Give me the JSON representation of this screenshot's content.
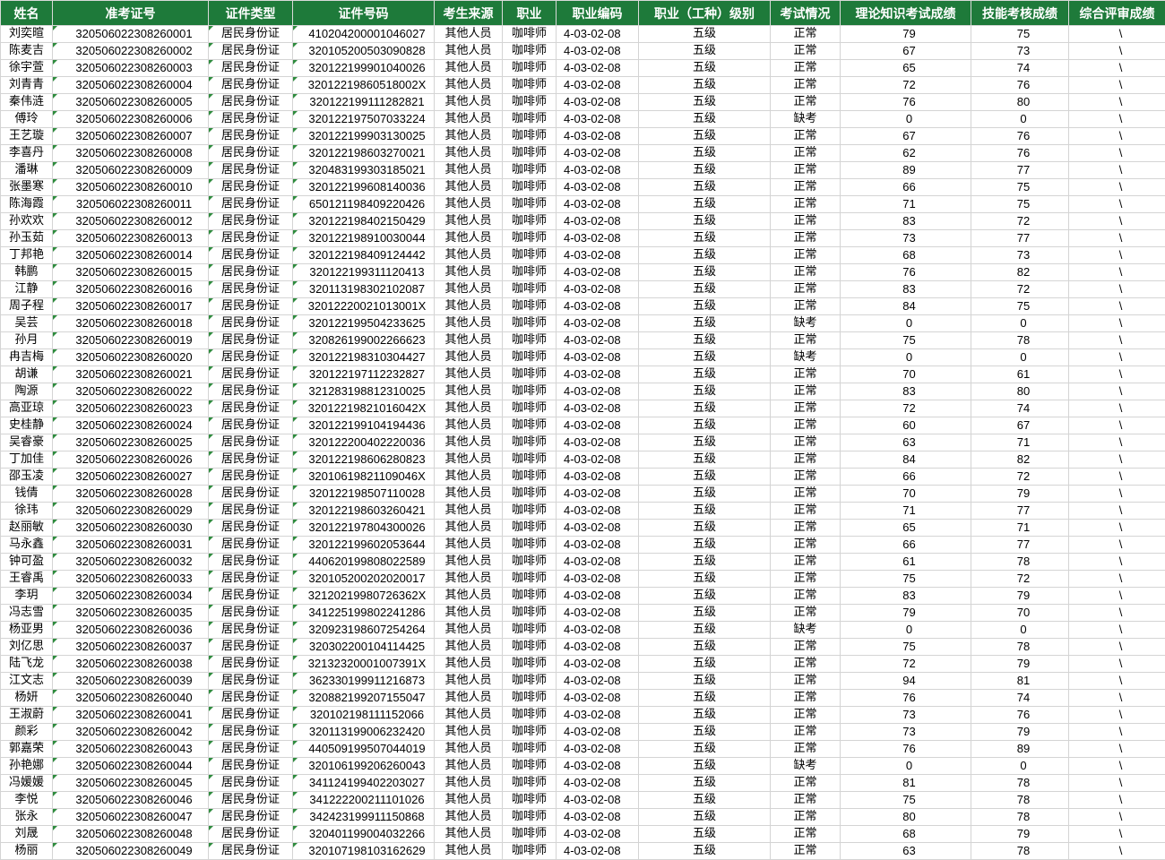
{
  "headers": [
    "姓名",
    "准考证号",
    "证件类型",
    "证件号码",
    "考生来源",
    "职业",
    "职业编码",
    "职业（工种）级别",
    "考试情况",
    "理论知识考试成绩",
    "技能考核成绩",
    "综合评审成绩"
  ],
  "rows": [
    [
      "刘奕暄",
      "320506022308260001",
      "居民身份证",
      "410204200001046027",
      "其他人员",
      "咖啡师",
      "4-03-02-08",
      "五级",
      "正常",
      "79",
      "75",
      "\\"
    ],
    [
      "陈麦吉",
      "320506022308260002",
      "居民身份证",
      "320105200503090828",
      "其他人员",
      "咖啡师",
      "4-03-02-08",
      "五级",
      "正常",
      "67",
      "73",
      "\\"
    ],
    [
      "徐宇萱",
      "320506022308260003",
      "居民身份证",
      "320122199901040026",
      "其他人员",
      "咖啡师",
      "4-03-02-08",
      "五级",
      "正常",
      "65",
      "74",
      "\\"
    ],
    [
      "刘青青",
      "320506022308260004",
      "居民身份证",
      "32012219860518002X",
      "其他人员",
      "咖啡师",
      "4-03-02-08",
      "五级",
      "正常",
      "72",
      "76",
      "\\"
    ],
    [
      "秦伟涟",
      "320506022308260005",
      "居民身份证",
      "320122199111282821",
      "其他人员",
      "咖啡师",
      "4-03-02-08",
      "五级",
      "正常",
      "76",
      "80",
      "\\"
    ],
    [
      "傅玲",
      "320506022308260006",
      "居民身份证",
      "320122197507033224",
      "其他人员",
      "咖啡师",
      "4-03-02-08",
      "五级",
      "缺考",
      "0",
      "0",
      "\\"
    ],
    [
      "王艺璇",
      "320506022308260007",
      "居民身份证",
      "320122199903130025",
      "其他人员",
      "咖啡师",
      "4-03-02-08",
      "五级",
      "正常",
      "67",
      "76",
      "\\"
    ],
    [
      "李喜丹",
      "320506022308260008",
      "居民身份证",
      "320122198603270021",
      "其他人员",
      "咖啡师",
      "4-03-02-08",
      "五级",
      "正常",
      "62",
      "76",
      "\\"
    ],
    [
      "潘琳",
      "320506022308260009",
      "居民身份证",
      "320483199303185021",
      "其他人员",
      "咖啡师",
      "4-03-02-08",
      "五级",
      "正常",
      "89",
      "77",
      "\\"
    ],
    [
      "张墨寒",
      "320506022308260010",
      "居民身份证",
      "320122199608140036",
      "其他人员",
      "咖啡师",
      "4-03-02-08",
      "五级",
      "正常",
      "66",
      "75",
      "\\"
    ],
    [
      "陈海霞",
      "320506022308260011",
      "居民身份证",
      "650121198409220426",
      "其他人员",
      "咖啡师",
      "4-03-02-08",
      "五级",
      "正常",
      "71",
      "75",
      "\\"
    ],
    [
      "孙欢欢",
      "320506022308260012",
      "居民身份证",
      "320122198402150429",
      "其他人员",
      "咖啡师",
      "4-03-02-08",
      "五级",
      "正常",
      "83",
      "72",
      "\\"
    ],
    [
      "孙玉茹",
      "320506022308260013",
      "居民身份证",
      "320122198910030044",
      "其他人员",
      "咖啡师",
      "4-03-02-08",
      "五级",
      "正常",
      "73",
      "77",
      "\\"
    ],
    [
      "丁邦艳",
      "320506022308260014",
      "居民身份证",
      "320122198409124442",
      "其他人员",
      "咖啡师",
      "4-03-02-08",
      "五级",
      "正常",
      "68",
      "73",
      "\\"
    ],
    [
      "韩鹏",
      "320506022308260015",
      "居民身份证",
      "320122199311120413",
      "其他人员",
      "咖啡师",
      "4-03-02-08",
      "五级",
      "正常",
      "76",
      "82",
      "\\"
    ],
    [
      "江静",
      "320506022308260016",
      "居民身份证",
      "320113198302102087",
      "其他人员",
      "咖啡师",
      "4-03-02-08",
      "五级",
      "正常",
      "83",
      "72",
      "\\"
    ],
    [
      "周子程",
      "320506022308260017",
      "居民身份证",
      "32012220021013001X",
      "其他人员",
      "咖啡师",
      "4-03-02-08",
      "五级",
      "正常",
      "84",
      "75",
      "\\"
    ],
    [
      "吴芸",
      "320506022308260018",
      "居民身份证",
      "320122199504233625",
      "其他人员",
      "咖啡师",
      "4-03-02-08",
      "五级",
      "缺考",
      "0",
      "0",
      "\\"
    ],
    [
      "孙月",
      "320506022308260019",
      "居民身份证",
      "320826199002266623",
      "其他人员",
      "咖啡师",
      "4-03-02-08",
      "五级",
      "正常",
      "75",
      "78",
      "\\"
    ],
    [
      "冉吉梅",
      "320506022308260020",
      "居民身份证",
      "320122198310304427",
      "其他人员",
      "咖啡师",
      "4-03-02-08",
      "五级",
      "缺考",
      "0",
      "0",
      "\\"
    ],
    [
      "胡谦",
      "320506022308260021",
      "居民身份证",
      "320122197112232827",
      "其他人员",
      "咖啡师",
      "4-03-02-08",
      "五级",
      "正常",
      "70",
      "61",
      "\\"
    ],
    [
      "陶源",
      "320506022308260022",
      "居民身份证",
      "321283198812310025",
      "其他人员",
      "咖啡师",
      "4-03-02-08",
      "五级",
      "正常",
      "83",
      "80",
      "\\"
    ],
    [
      "高亚琼",
      "320506022308260023",
      "居民身份证",
      "32012219821016042X",
      "其他人员",
      "咖啡师",
      "4-03-02-08",
      "五级",
      "正常",
      "72",
      "74",
      "\\"
    ],
    [
      "史桂静",
      "320506022308260024",
      "居民身份证",
      "320122199104194436",
      "其他人员",
      "咖啡师",
      "4-03-02-08",
      "五级",
      "正常",
      "60",
      "67",
      "\\"
    ],
    [
      "吴睿豪",
      "320506022308260025",
      "居民身份证",
      "320122200402220036",
      "其他人员",
      "咖啡师",
      "4-03-02-08",
      "五级",
      "正常",
      "63",
      "71",
      "\\"
    ],
    [
      "丁加佳",
      "320506022308260026",
      "居民身份证",
      "320122198606280823",
      "其他人员",
      "咖啡师",
      "4-03-02-08",
      "五级",
      "正常",
      "84",
      "82",
      "\\"
    ],
    [
      "邵玉凌",
      "320506022308260027",
      "居民身份证",
      "32010619821109046X",
      "其他人员",
      "咖啡师",
      "4-03-02-08",
      "五级",
      "正常",
      "66",
      "72",
      "\\"
    ],
    [
      "钱倩",
      "320506022308260028",
      "居民身份证",
      "320122198507110028",
      "其他人员",
      "咖啡师",
      "4-03-02-08",
      "五级",
      "正常",
      "70",
      "79",
      "\\"
    ],
    [
      "徐玮",
      "320506022308260029",
      "居民身份证",
      "320122198603260421",
      "其他人员",
      "咖啡师",
      "4-03-02-08",
      "五级",
      "正常",
      "71",
      "77",
      "\\"
    ],
    [
      "赵丽敏",
      "320506022308260030",
      "居民身份证",
      "320122197804300026",
      "其他人员",
      "咖啡师",
      "4-03-02-08",
      "五级",
      "正常",
      "65",
      "71",
      "\\"
    ],
    [
      "马永鑫",
      "320506022308260031",
      "居民身份证",
      "320122199602053644",
      "其他人员",
      "咖啡师",
      "4-03-02-08",
      "五级",
      "正常",
      "66",
      "77",
      "\\"
    ],
    [
      "钟可盈",
      "320506022308260032",
      "居民身份证",
      "440620199808022589",
      "其他人员",
      "咖啡师",
      "4-03-02-08",
      "五级",
      "正常",
      "61",
      "78",
      "\\"
    ],
    [
      "王睿禹",
      "320506022308260033",
      "居民身份证",
      "320105200202020017",
      "其他人员",
      "咖啡师",
      "4-03-02-08",
      "五级",
      "正常",
      "75",
      "72",
      "\\"
    ],
    [
      "李玥",
      "320506022308260034",
      "居民身份证",
      "32120219980726362X",
      "其他人员",
      "咖啡师",
      "4-03-02-08",
      "五级",
      "正常",
      "83",
      "79",
      "\\"
    ],
    [
      "冯志雪",
      "320506022308260035",
      "居民身份证",
      "341225199802241286",
      "其他人员",
      "咖啡师",
      "4-03-02-08",
      "五级",
      "正常",
      "79",
      "70",
      "\\"
    ],
    [
      "杨亚男",
      "320506022308260036",
      "居民身份证",
      "320923198607254264",
      "其他人员",
      "咖啡师",
      "4-03-02-08",
      "五级",
      "缺考",
      "0",
      "0",
      "\\"
    ],
    [
      "刘亿思",
      "320506022308260037",
      "居民身份证",
      "320302200104114425",
      "其他人员",
      "咖啡师",
      "4-03-02-08",
      "五级",
      "正常",
      "75",
      "78",
      "\\"
    ],
    [
      "陆飞龙",
      "320506022308260038",
      "居民身份证",
      "32132320001007391X",
      "其他人员",
      "咖啡师",
      "4-03-02-08",
      "五级",
      "正常",
      "72",
      "79",
      "\\"
    ],
    [
      "江文志",
      "320506022308260039",
      "居民身份证",
      "362330199911216873",
      "其他人员",
      "咖啡师",
      "4-03-02-08",
      "五级",
      "正常",
      "94",
      "81",
      "\\"
    ],
    [
      "杨妍",
      "320506022308260040",
      "居民身份证",
      "320882199207155047",
      "其他人员",
      "咖啡师",
      "4-03-02-08",
      "五级",
      "正常",
      "76",
      "74",
      "\\"
    ],
    [
      "王淑蔚",
      "320506022308260041",
      "居民身份证",
      "320102198111152066",
      "其他人员",
      "咖啡师",
      "4-03-02-08",
      "五级",
      "正常",
      "73",
      "76",
      "\\"
    ],
    [
      "颜彩",
      "320506022308260042",
      "居民身份证",
      "320113199006232420",
      "其他人员",
      "咖啡师",
      "4-03-02-08",
      "五级",
      "正常",
      "73",
      "79",
      "\\"
    ],
    [
      "郭嘉荣",
      "320506022308260043",
      "居民身份证",
      "440509199507044019",
      "其他人员",
      "咖啡师",
      "4-03-02-08",
      "五级",
      "正常",
      "76",
      "89",
      "\\"
    ],
    [
      "孙艳娜",
      "320506022308260044",
      "居民身份证",
      "320106199206260043",
      "其他人员",
      "咖啡师",
      "4-03-02-08",
      "五级",
      "缺考",
      "0",
      "0",
      "\\"
    ],
    [
      "冯媛媛",
      "320506022308260045",
      "居民身份证",
      "341124199402203027",
      "其他人员",
      "咖啡师",
      "4-03-02-08",
      "五级",
      "正常",
      "81",
      "78",
      "\\"
    ],
    [
      "李悦",
      "320506022308260046",
      "居民身份证",
      "341222200211101026",
      "其他人员",
      "咖啡师",
      "4-03-02-08",
      "五级",
      "正常",
      "75",
      "78",
      "\\"
    ],
    [
      "张永",
      "320506022308260047",
      "居民身份证",
      "342423199911150868",
      "其他人员",
      "咖啡师",
      "4-03-02-08",
      "五级",
      "正常",
      "80",
      "78",
      "\\"
    ],
    [
      "刘晟",
      "320506022308260048",
      "居民身份证",
      "320401199004032266",
      "其他人员",
      "咖啡师",
      "4-03-02-08",
      "五级",
      "正常",
      "68",
      "79",
      "\\"
    ],
    [
      "杨丽",
      "320506022308260049",
      "居民身份证",
      "320107198103162629",
      "其他人员",
      "咖啡师",
      "4-03-02-08",
      "五级",
      "正常",
      "63",
      "78",
      "\\"
    ]
  ]
}
